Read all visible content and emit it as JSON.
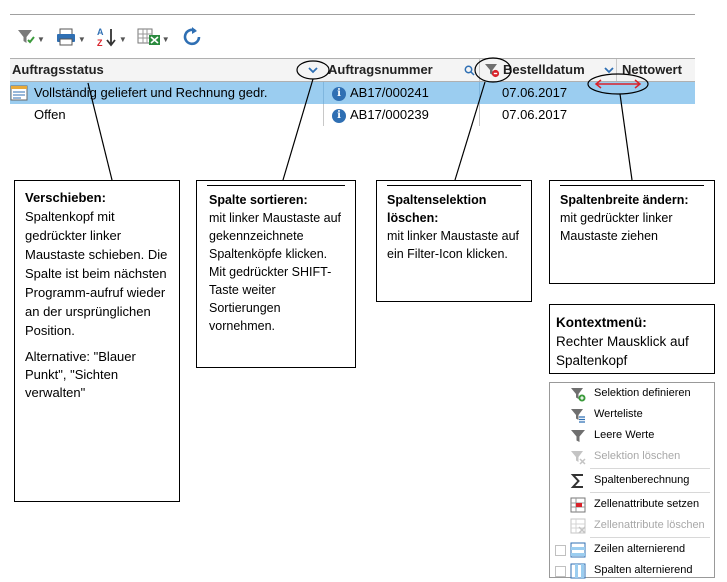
{
  "toolbar": {
    "buttons": [
      {
        "icon": "filter-icon"
      },
      {
        "icon": "print-icon"
      },
      {
        "icon": "sort-az-icon"
      },
      {
        "icon": "excel-export-icon"
      },
      {
        "icon": "refresh-icon"
      }
    ]
  },
  "grid": {
    "columns": [
      "Auftragsstatus",
      "Auftragsnummer",
      "Bestelldatum",
      "Nettowert"
    ],
    "rows": [
      {
        "status": "Vollständig geliefert und Rechnung gedr.",
        "number": "AB17/000241",
        "date": "07.06.2017",
        "selected": true
      },
      {
        "status": "Offen",
        "number": "AB17/000239",
        "date": "07.06.2017",
        "selected": false
      }
    ]
  },
  "callouts": {
    "move": {
      "title": "Verschieben:",
      "body": "Spaltenkopf mit gedrückter linker Maustaste schieben. Die Spalte ist beim nächsten Programm-aufruf wieder an der ursprünglichen Position.",
      "alt": "Alternative: \"Blauer Punkt\", \"Sichten verwalten\""
    },
    "sort": {
      "title": "Spalte sortieren:",
      "body": "mit linker Maustaste auf gekennzeichnete Spaltenköpfe klicken. Mit gedrückter SHIFT-Taste weiter Sortierungen vornehmen."
    },
    "filter": {
      "title": "Spaltenselektion löschen:",
      "body": "mit linker Maustaste auf ein Filter-Icon klicken."
    },
    "width": {
      "title": "Spaltenbreite ändern:",
      "body": "mit gedrückter linker Maustaste ziehen"
    },
    "context": {
      "title": "Kontextmenü:",
      "body": "Rechter Mausklick auf Spaltenkopf"
    }
  },
  "context_menu": {
    "items": [
      {
        "label": "Selektion definieren",
        "icon": "filter-add-icon",
        "disabled": false
      },
      {
        "label": "Werteliste",
        "icon": "filter-list-icon",
        "disabled": false
      },
      {
        "label": "Leere Werte",
        "icon": "filter-icon",
        "disabled": false
      },
      {
        "label": "Selektion löschen",
        "icon": "filter-clear-icon",
        "disabled": true
      },
      {
        "label": "Spaltenberechnung",
        "icon": "sum-icon",
        "disabled": false
      },
      {
        "label": "Zellenattribute setzen",
        "icon": "cell-attributes-icon",
        "disabled": false
      },
      {
        "label": "Zellenattribute löschen",
        "icon": "cell-attributes-clear-icon",
        "disabled": true
      },
      {
        "label": "Zeilen alternierend",
        "icon": "rows-alternate-icon",
        "disabled": false
      },
      {
        "label": "Spalten alternierend",
        "icon": "columns-alternate-icon",
        "disabled": false
      }
    ]
  },
  "colors": {
    "selection": "#9bcdf0",
    "accent": "#2f6fb3",
    "arrow": "#d9222a"
  }
}
